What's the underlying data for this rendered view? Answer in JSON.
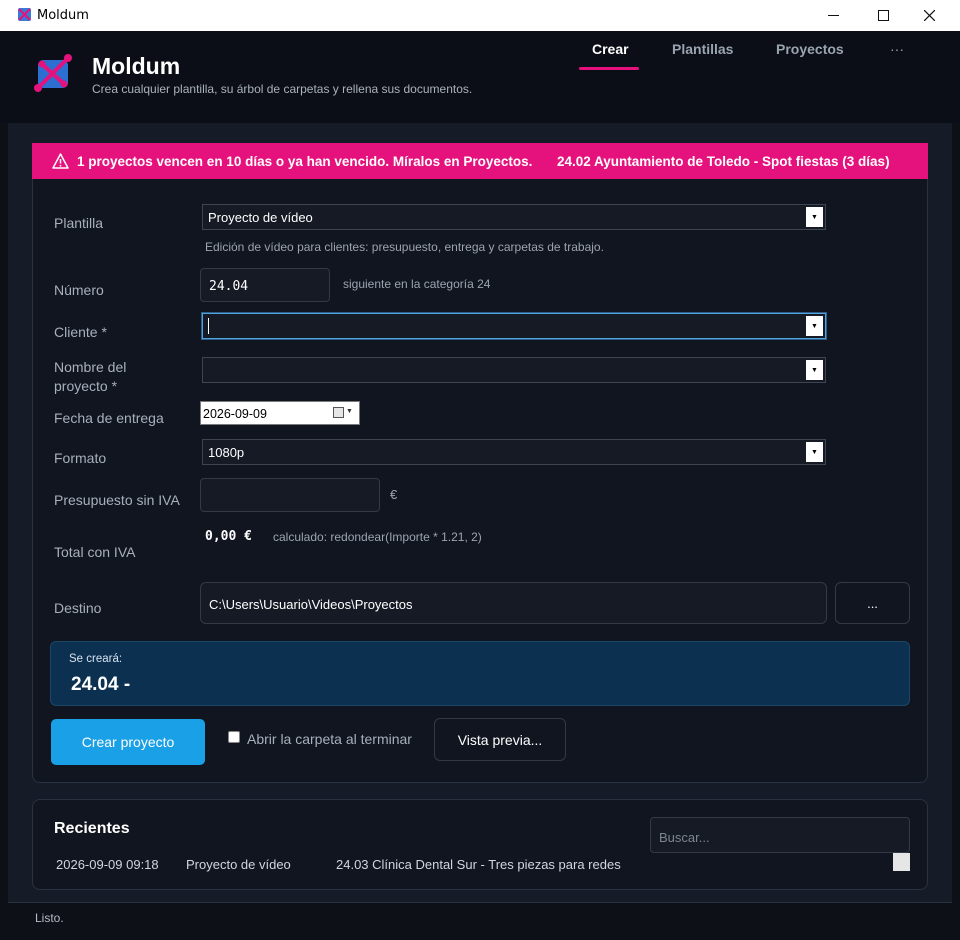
{
  "window": {
    "title": "Moldum",
    "minimize": "—",
    "maximize": "☐",
    "close": "✕"
  },
  "header": {
    "app_name": "Moldum",
    "subtitle": "Crea cualquier plantilla, su árbol de carpetas y rellena sus documentos.",
    "tabs": [
      {
        "label": "Crear",
        "active": true
      },
      {
        "label": "Plantillas",
        "active": false
      },
      {
        "label": "Proyectos",
        "active": false
      },
      {
        "label": "···",
        "active": false
      }
    ]
  },
  "alert": {
    "text": "1 proyectos vencen en 10 días o ya han vencido. Míralos en Proyectos.",
    "item": "24.02 Ayuntamiento de Toledo - Spot fiestas (3 días)",
    "color": "#e5127d"
  },
  "form": {
    "plantilla": {
      "label": "Plantilla",
      "value": "Proyecto de vídeo",
      "description": "Edición de vídeo para clientes: presupuesto, entrega y carpetas de trabajo."
    },
    "numero": {
      "label": "Número",
      "value": "24.04",
      "hint": "siguiente en la categoría 24"
    },
    "cliente": {
      "label": "Cliente *",
      "value": ""
    },
    "nombre": {
      "label_line1": "Nombre del",
      "label_line2": "proyecto *",
      "value": ""
    },
    "fecha": {
      "label": "Fecha de entrega",
      "value": "2026-09-09"
    },
    "formato": {
      "label": "Formato",
      "value": "1080p"
    },
    "presupuesto": {
      "label": "Presupuesto sin IVA",
      "value": "",
      "unit": "€"
    },
    "total": {
      "label": "Total con IVA",
      "value": "0,00 €",
      "formula": "calculado: redondear(Importe * 1.21, 2)"
    },
    "destino": {
      "label": "Destino",
      "value": "C:\\Users\\Usuario\\Videos\\Proyectos",
      "browse": "..."
    }
  },
  "preview": {
    "caption": "Se creará:",
    "name": "24.04 -"
  },
  "actions": {
    "create": "Crear proyecto",
    "open_folder": "Abrir la carpeta al terminar",
    "open_folder_checked": false,
    "preview": "Vista previa..."
  },
  "recent": {
    "title": "Recientes",
    "search_placeholder": "Buscar...",
    "rows": [
      {
        "date": "2026-09-09 09:18",
        "template": "Proyecto de vídeo",
        "project": "24.03 Clínica Dental Sur - Tres piezas para redes"
      }
    ]
  },
  "status": "Listo.",
  "colors": {
    "accent": "#e5127d",
    "primary": "#1aa0e6",
    "background": "#0d1117",
    "preview_bg": "#0c3050"
  }
}
